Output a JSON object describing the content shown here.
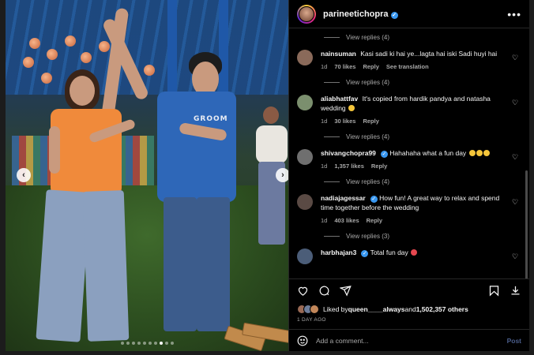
{
  "post": {
    "username": "parineetichopra",
    "more_label": "•••"
  },
  "photo": {
    "shirt_text": "GROOM",
    "nav_prev": "‹",
    "nav_next": "›",
    "dot_count": 10,
    "active_dot": 7
  },
  "comments": [
    {
      "type": "replies",
      "label": "View replies (4)"
    },
    {
      "type": "comment",
      "user": "nainsuman",
      "verified": false,
      "text": "Kasi sadi ki hai ye...lagta hai iski Sadi huyi hai",
      "emoji": "",
      "time": "1d",
      "likes": "70 likes",
      "reply": "Reply",
      "extra": "See translation",
      "avatar_color": "#8a6a5a"
    },
    {
      "type": "replies",
      "label": "View replies (4)"
    },
    {
      "type": "comment",
      "user": "aliabhattfav",
      "verified": false,
      "text": "It's copied from hardik pandya and natasha wedding",
      "emoji": "yellow",
      "time": "1d",
      "likes": "30 likes",
      "reply": "Reply",
      "extra": "",
      "avatar_color": "#7b8f6e"
    },
    {
      "type": "replies",
      "label": "View replies (4)"
    },
    {
      "type": "comment",
      "user": "shivangchopra99",
      "verified": true,
      "text": "Hahahaha what a fun day",
      "emoji": "triple",
      "time": "1d",
      "likes": "1,357 likes",
      "reply": "Reply",
      "extra": "",
      "avatar_color": "#6f6f6f"
    },
    {
      "type": "replies",
      "label": "View replies (4)"
    },
    {
      "type": "comment",
      "user": "nadiajagessar",
      "verified": true,
      "text": "How fun! A great way to relax and spend time together before the wedding",
      "emoji": "",
      "time": "1d",
      "likes": "403 likes",
      "reply": "Reply",
      "extra": "",
      "avatar_color": "#5a4a44"
    },
    {
      "type": "replies",
      "label": "View replies (3)"
    },
    {
      "type": "comment",
      "user": "harbhajan3",
      "verified": true,
      "text": "Total fun day",
      "emoji": "red",
      "time": "",
      "likes": "",
      "reply": "",
      "extra": "",
      "avatar_color": "#4b5d78"
    }
  ],
  "likes": {
    "prefix": "Liked by ",
    "user": "queen____always",
    "middle": " and ",
    "count": "1,502,357 others"
  },
  "time_ago": "1 DAY AGO",
  "add_comment": {
    "placeholder": "Add a comment...",
    "post_label": "Post"
  },
  "colors": {
    "accent": "#3897f0",
    "background": "#000000",
    "muted_text": "#a8a8a8",
    "post_disabled": "#4a5d8a"
  }
}
